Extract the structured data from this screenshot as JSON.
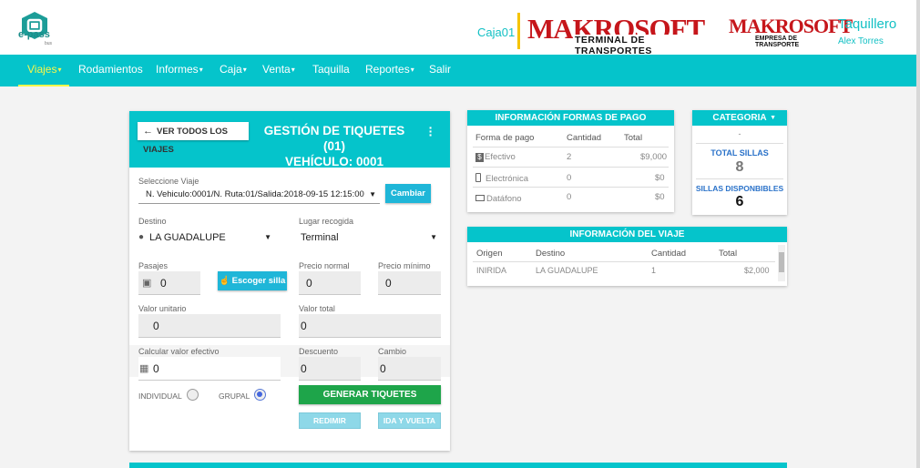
{
  "brand": {
    "logo_text": "e-pass",
    "logo_sub": "bus"
  },
  "header": {
    "caja": "Caja01",
    "logo1_big": "MAKROSOFT",
    "logo1_small": "TERMINAL DE TRANSPORTES",
    "logo2_big": "MAKROSOFT",
    "logo2_small": "EMPRESA DE TRANSPORTE",
    "user_role": "Taquillero",
    "user_name": "Alex Torres"
  },
  "nav": [
    {
      "label": "Viajes",
      "dropdown": true,
      "active": true
    },
    {
      "label": "Rodamientos",
      "dropdown": false
    },
    {
      "label": "Informes",
      "dropdown": true
    },
    {
      "label": "Caja",
      "dropdown": true
    },
    {
      "label": "Venta",
      "dropdown": true
    },
    {
      "label": "Taquilla",
      "dropdown": false
    },
    {
      "label": "Reportes",
      "dropdown": true
    },
    {
      "label": "Salir",
      "dropdown": false
    }
  ],
  "form": {
    "back_label": "VER TODOS LOS VIAJES",
    "title_line1": "GESTIÓN DE TIQUETES (01)",
    "title_line2": "VEHÍCULO: 0001",
    "trip_label": "Seleccione Viaje",
    "trip_value": "N. Vehiculo:0001/N. Ruta:01/Salida:2018-09-15 12:15:00",
    "change_label": "Cambiar",
    "destino_label": "Destino",
    "destino_value": "LA GUADALUPE",
    "recogida_label": "Lugar recogida",
    "recogida_value": "Terminal",
    "pasajes_label": "Pasajes",
    "pasajes_value": "0",
    "seat_label": "Escoger silla",
    "precio_normal_label": "Precio normal",
    "precio_normal_value": "0",
    "precio_min_label": "Precio mínimo",
    "precio_min_value": "0",
    "valor_unit_label": "Valor unitario",
    "valor_unit_value": "0",
    "valor_total_label": "Valor total",
    "valor_total_value": "0",
    "calc_label": "Calcular valor efectivo",
    "calc_value": "0",
    "descuento_label": "Descuento",
    "descuento_value": "0",
    "cambio_label": "Cambio",
    "cambio_value": "0",
    "individual_label": "INDIVIDUAL",
    "grupal_label": "GRUPAL",
    "generate_label": "GENERAR TIQUETES",
    "redimir_label": "REDIMIR",
    "idavuelta_label": "IDA Y VUELTA"
  },
  "payments": {
    "title": "INFORMACIÓN FORMAS DE PAGO",
    "headers": [
      "Forma de pago",
      "Cantidad",
      "Total"
    ],
    "rows": [
      {
        "icon": "cash-icon",
        "name": "Efectivo",
        "qty": "2",
        "total": "$9,000"
      },
      {
        "icon": "phone-icon",
        "name": "Electrónica",
        "qty": "0",
        "total": "$0"
      },
      {
        "icon": "card-icon",
        "name": "Datáfono",
        "qty": "0",
        "total": "$0"
      }
    ]
  },
  "category": {
    "title": "CATEGORIA",
    "dash": "-",
    "total_label": "TOTAL SILLAS",
    "total_value": "8",
    "available_label": "SILLAS DISPONBIBLES",
    "available_value": "6"
  },
  "trip": {
    "title": "INFORMACIÓN DEL VIAJE",
    "headers": [
      "Origen",
      "Destino",
      "Cantidad",
      "Total"
    ],
    "rows": [
      {
        "origen": "INIRIDA",
        "destino": "LA GUADALUPE",
        "cantidad": "1",
        "total": "$2,000"
      }
    ]
  },
  "colors": {
    "accent": "#05c4cb",
    "active_nav": "#f7f74a",
    "brand_red": "#c6161b",
    "green": "#1ea54a"
  }
}
